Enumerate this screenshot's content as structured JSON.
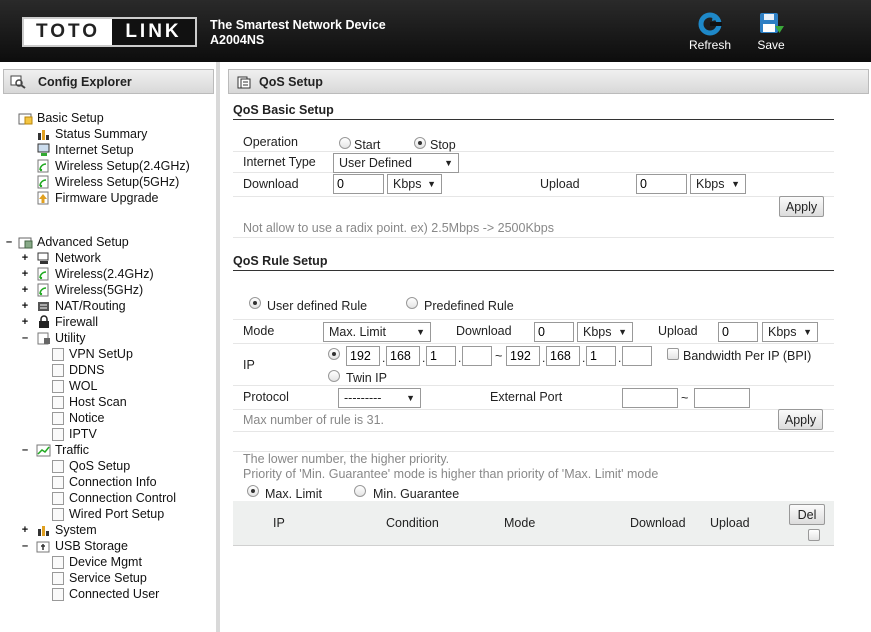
{
  "header": {
    "logo_left": "TOTO",
    "logo_right": "LINK",
    "tagline": "The Smartest Network Device",
    "model": "A2004NS",
    "refresh_label": "Refresh",
    "save_label": "Save"
  },
  "explorer": {
    "title": "Config Explorer",
    "basic_setup": "Basic Setup",
    "basic_items": [
      "Status Summary",
      "Internet Setup",
      "Wireless Setup(2.4GHz)",
      "Wireless Setup(5GHz)",
      "Firmware Upgrade"
    ],
    "advanced_setup": "Advanced Setup",
    "advanced_items": [
      "Network",
      "Wireless(2.4GHz)",
      "Wireless(5GHz)",
      "NAT/Routing",
      "Firewall",
      "Utility"
    ],
    "utility_items": [
      "VPN SetUp",
      "DDNS",
      "WOL",
      "Host Scan",
      "Notice",
      "IPTV"
    ],
    "traffic": "Traffic",
    "traffic_items": [
      "QoS Setup",
      "Connection Info",
      "Connection Control",
      "Wired Port Setup"
    ],
    "system": "System",
    "usb_storage": "USB Storage",
    "usb_items": [
      "Device Mgmt",
      "Service Setup",
      "Connected User"
    ]
  },
  "content": {
    "title": "QoS Setup",
    "basic": {
      "section_title": "QoS Basic Setup",
      "operation_label": "Operation",
      "start_label": "Start",
      "stop_label": "Stop",
      "internet_type_label": "Internet Type",
      "internet_type_value": "User Defined",
      "download_label": "Download",
      "download_value": "0",
      "download_unit": "Kbps",
      "upload_label": "Upload",
      "upload_value": "0",
      "upload_unit": "Kbps",
      "apply_label": "Apply",
      "note": "Not allow to use a radix point. ex) 2.5Mbps -> 2500Kbps"
    },
    "rule": {
      "section_title": "QoS Rule Setup",
      "user_defined_label": "User defined Rule",
      "predefined_label": "Predefined Rule",
      "mode_label": "Mode",
      "mode_value": "Max. Limit",
      "download_label": "Download",
      "download_value": "0",
      "download_unit": "Kbps",
      "upload_label": "Upload",
      "upload_value": "0",
      "upload_unit": "Kbps",
      "ip_label": "IP",
      "ip_start": [
        "192",
        "168",
        "1",
        ""
      ],
      "ip_end": [
        "192",
        "168",
        "1",
        ""
      ],
      "tilde": "~",
      "bpi_label": "Bandwidth Per IP (BPI)",
      "twin_ip_label": "Twin IP",
      "protocol_label": "Protocol",
      "protocol_value": "---------",
      "external_port_label": "External Port",
      "max_rule_note": "Max number of rule is 31.",
      "apply_label": "Apply",
      "priority_note_1": "The lower number, the higher priority.",
      "priority_note_2": "Priority of 'Min. Guarantee' mode is higher than priority of 'Max. Limit' mode",
      "max_limit_label": "Max. Limit",
      "min_guarantee_label": "Min. Guarantee"
    },
    "table": {
      "columns": [
        "IP",
        "Condition",
        "Mode",
        "Download",
        "Upload"
      ],
      "del_label": "Del"
    }
  },
  "colors": {
    "header_bg": "#111111",
    "accent_blue": "#1e88c8",
    "save_green": "#3aa83a"
  }
}
